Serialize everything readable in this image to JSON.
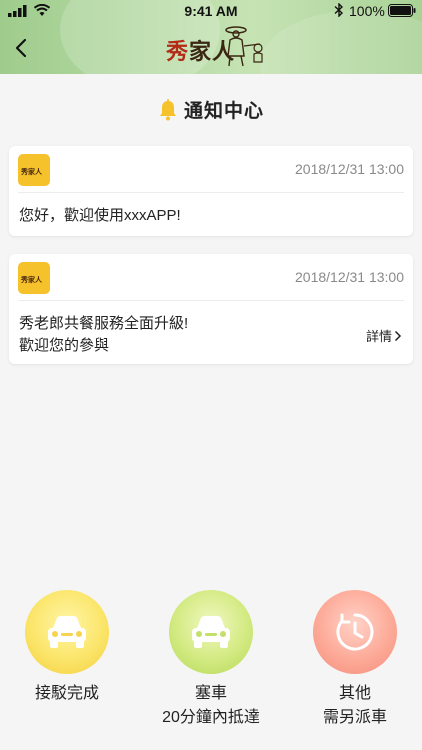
{
  "status_bar": {
    "time": "9:41 AM",
    "battery_text": "100%",
    "icons": [
      "signal-icon",
      "wifi-icon",
      "bluetooth-icon",
      "battery-icon"
    ]
  },
  "header": {
    "logo_text_first": "秀",
    "logo_text_rest": "家人",
    "back_icon": "chevron-left-icon"
  },
  "page": {
    "title": "通知中心",
    "title_icon": "bell-icon"
  },
  "notifications": [
    {
      "avatar_text": "秀家人",
      "date": "2018/12/31 13:00",
      "lines": [
        "您好，歡迎使用xxxAPP!"
      ]
    },
    {
      "avatar_text": "秀家人",
      "date": "2018/12/31 13:00",
      "lines": [
        "秀老郎共餐服務全面升級!",
        "歡迎您的參與"
      ],
      "detail_label": "詳情"
    }
  ],
  "actions": [
    {
      "icon": "car-icon",
      "line1": "接駁完成",
      "line2": "",
      "color": "#f7d64a"
    },
    {
      "icon": "car-icon",
      "line1": "塞車",
      "line2": "20分鐘內抵達",
      "color": "#c5e26b"
    },
    {
      "icon": "clock-icon",
      "line1": "其他",
      "line2": "需另派車",
      "color": "#f99e8c"
    }
  ],
  "colors": {
    "header_green": "#b8dba6",
    "bell_yellow": "#f6c22b",
    "avatar_yellow": "#f6c22b"
  }
}
